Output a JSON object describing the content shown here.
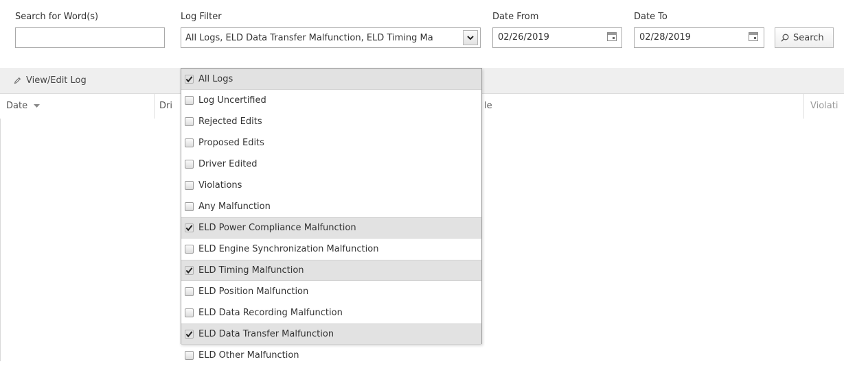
{
  "filters": {
    "search_label": "Search for Word(s)",
    "search_value": "",
    "log_filter_label": "Log Filter",
    "log_filter_value": "All Logs, ELD Data Transfer Malfunction, ELD Timing Ma",
    "date_from_label": "Date From",
    "date_from_value": "02/26/2019",
    "date_to_label": "Date To",
    "date_to_value": "02/28/2019",
    "search_button_label": "Search"
  },
  "toolbar": {
    "view_edit_label": "View/Edit Log"
  },
  "grid": {
    "columns": [
      "Date",
      "Dri",
      "le",
      "Violati"
    ]
  },
  "log_filter_options": [
    {
      "label": "All Logs",
      "checked": true
    },
    {
      "label": "Log Uncertified",
      "checked": false
    },
    {
      "label": "Rejected Edits",
      "checked": false
    },
    {
      "label": "Proposed Edits",
      "checked": false
    },
    {
      "label": "Driver Edited",
      "checked": false
    },
    {
      "label": "Violations",
      "checked": false
    },
    {
      "label": "Any Malfunction",
      "checked": false
    },
    {
      "label": "ELD Power Compliance Malfunction",
      "checked": true
    },
    {
      "label": "ELD Engine Synchronization Malfunction",
      "checked": false
    },
    {
      "label": "ELD Timing Malfunction",
      "checked": true
    },
    {
      "label": "ELD Position Malfunction",
      "checked": false
    },
    {
      "label": "ELD Data Recording Malfunction",
      "checked": false
    },
    {
      "label": "ELD Data Transfer Malfunction",
      "checked": true
    },
    {
      "label": "ELD Other Malfunction",
      "checked": false
    }
  ],
  "icons": {
    "dropdown_arrow": "chevron-down-icon",
    "calendar": "calendar-icon",
    "search": "search-icon",
    "edit": "pencil-icon",
    "sort": "sort-down-icon",
    "check": "checkmark-icon"
  }
}
